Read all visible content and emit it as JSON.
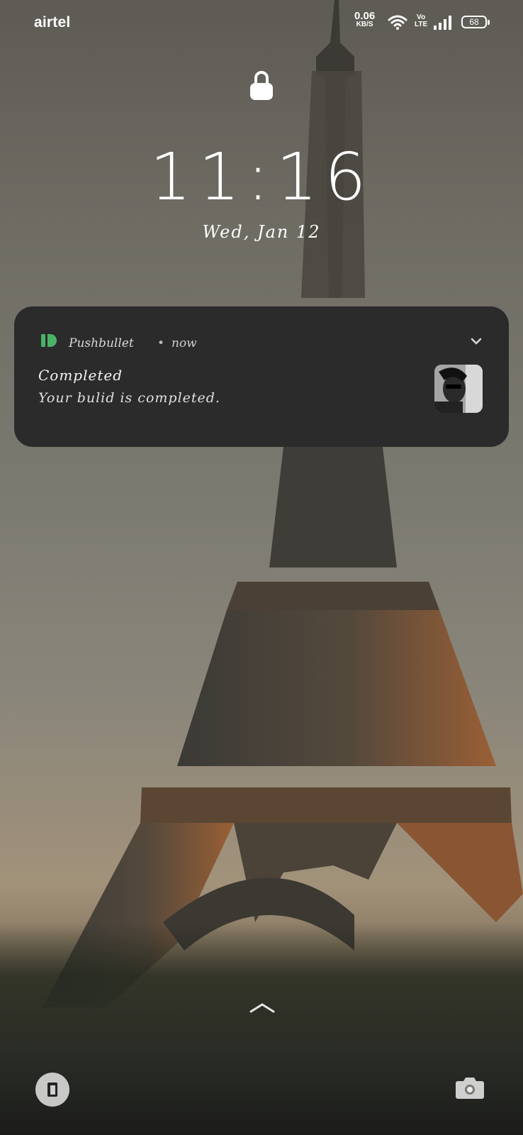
{
  "status_bar": {
    "carrier": "airtel",
    "speed_value": "0.06",
    "speed_unit": "KB/S",
    "volte_top": "Vo",
    "volte_bottom": "LTE",
    "battery": "68",
    "icons": [
      "wifi-icon",
      "signal-icon",
      "battery-icon"
    ]
  },
  "lockscreen": {
    "lock_icon": "lock-icon",
    "time": "11:16",
    "date": "Wed, Jan 12"
  },
  "notification": {
    "app_name": "Pushbullet",
    "separator": "•",
    "time": "now",
    "title": "Completed",
    "body": "Your bulid is completed.",
    "app_icon": "pushbullet-icon",
    "accent_color": "#4ab367"
  },
  "bottom": {
    "icons": [
      "swipe-up-icon",
      "wallet-icon",
      "camera-icon"
    ]
  }
}
